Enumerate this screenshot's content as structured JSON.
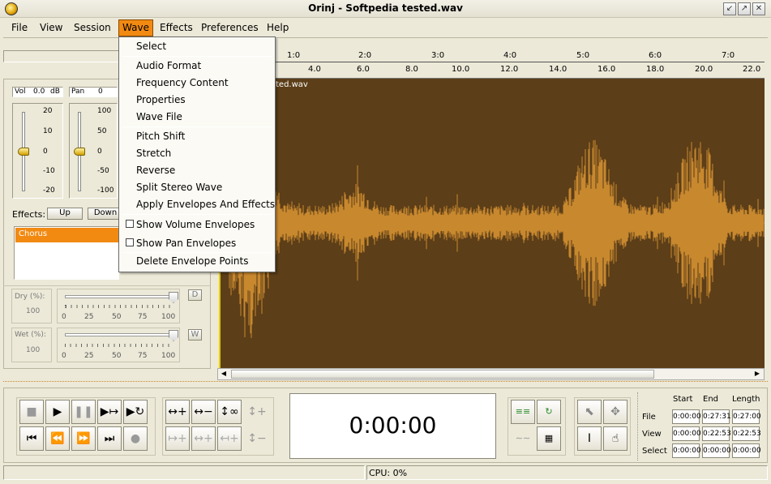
{
  "window": {
    "title": "Orinj - Softpedia tested.wav"
  },
  "menubar": [
    "File",
    "View",
    "Session",
    "Wave",
    "Effects",
    "Preferences",
    "Help"
  ],
  "wave_menu": {
    "group1": [
      "Select"
    ],
    "group2": [
      "Audio Format",
      "Frequency Content",
      "Properties",
      "Wave File"
    ],
    "group3": [
      "Pitch Shift",
      "Stretch",
      "Reverse",
      "Split Stereo Wave",
      "Apply Envelopes And Effects"
    ],
    "group4": [
      "Show Volume Envelopes",
      "Show Pan Envelopes"
    ],
    "group5": [
      "Delete Envelope Points"
    ]
  },
  "ruler": {
    "top": [
      "1:0",
      "2:0",
      "3:0",
      "4:0",
      "5:0",
      "6:0",
      "7:0"
    ],
    "bottom": [
      "4.0",
      "6.0",
      "8.0",
      "10.0",
      "12.0",
      "14.0",
      "16.0",
      "18.0",
      "20.0",
      "22.0"
    ]
  },
  "track": {
    "label": "ted.wav",
    "wave_color": "#c8882e",
    "bg_color": "#5c3e18"
  },
  "mixer": {
    "vol_label": "Vol",
    "vol_value": "0.0",
    "vol_unit": "dB",
    "pan_label": "Pan",
    "pan_value": "0",
    "vol_scale": [
      "20",
      "10",
      "0",
      "-10",
      "-20"
    ],
    "pan_scale": [
      "100",
      "50",
      "0",
      "-50",
      "-100"
    ]
  },
  "effects": {
    "label": "Effects:",
    "up": "Up",
    "down": "Down",
    "selected_item": "Chorus"
  },
  "dry": {
    "label": "Dry (%):",
    "value": "100",
    "btn": "D",
    "ticks": [
      "0",
      "25",
      "50",
      "75",
      "100"
    ],
    "level": 1.0
  },
  "wet": {
    "label": "Wet (%):",
    "value": "100",
    "btn": "W",
    "ticks": [
      "0",
      "25",
      "50",
      "75",
      "100"
    ],
    "level": 1.0
  },
  "time": {
    "display": "0:00:00"
  },
  "positions": {
    "headers": [
      "Start",
      "End",
      "Length"
    ],
    "rows": [
      {
        "label": "File",
        "start": "0:00:00",
        "end": "0:27:31",
        "length": "0:27:00"
      },
      {
        "label": "View",
        "start": "0:00:00",
        "end": "0:22:53",
        "length": "0:22:53"
      },
      {
        "label": "Select",
        "start": "0:00:00",
        "end": "0:00:00",
        "length": "0:00:00"
      }
    ]
  },
  "status": {
    "cpu": "CPU: 0%"
  }
}
